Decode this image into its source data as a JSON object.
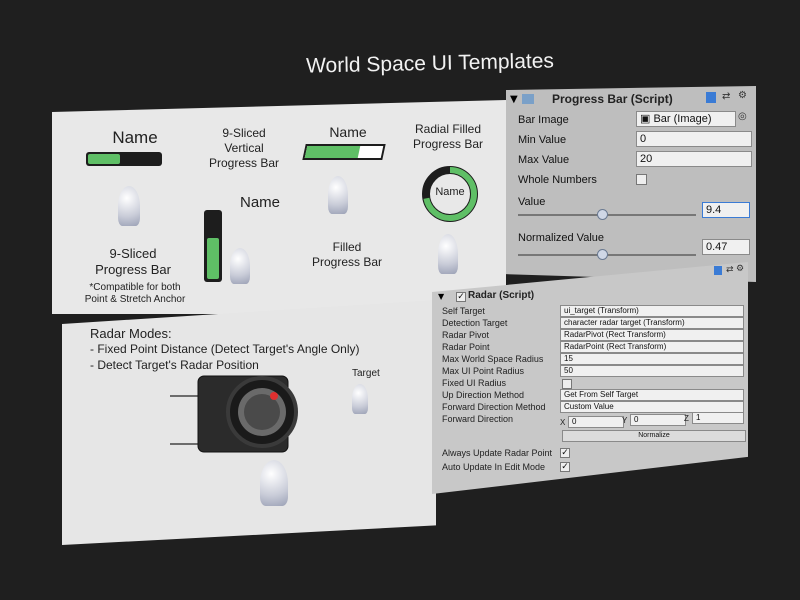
{
  "page_title": "World Space UI Templates",
  "templates": {
    "sliced_bar": {
      "name": "Name",
      "label": "9-Sliced\nProgress Bar",
      "note": "*Compatible for both\nPoint & Stretch Anchor",
      "fill_fraction": 0.45
    },
    "vertical_bar": {
      "label": "9-Sliced\nVertical\nProgress Bar",
      "name": "Name",
      "fill_fraction": 0.62
    },
    "filled_bar": {
      "name": "Name",
      "label": "Filled\nProgress Bar",
      "fill_fraction": 0.7
    },
    "radial_bar": {
      "label": "Radial Filled\nProgress Bar",
      "name": "Name",
      "fill_fraction": 0.72
    }
  },
  "radar_demo": {
    "heading": "Radar Modes:",
    "modes": [
      "- Fixed Point Distance (Detect Target's Angle Only)",
      "- Detect Target's Radar Position"
    ],
    "target_label": "Target"
  },
  "progress_bar_inspector": {
    "component_title": "Progress Bar (Script)",
    "fields": [
      {
        "label": "Bar Image",
        "value": "Bar (Image)"
      },
      {
        "label": "Min Value",
        "value": "0"
      },
      {
        "label": "Max Value",
        "value": "20"
      },
      {
        "label": "Whole Numbers",
        "value": ""
      }
    ],
    "value_label": "Value",
    "value": "9.4",
    "value_fraction": 0.47,
    "normalized_label": "Normalized Value",
    "normalized_value": "0.47",
    "normalized_fraction": 0.47
  },
  "radar_inspector": {
    "component_title": "Radar (Script)",
    "rows": [
      {
        "label": "Self Target",
        "value": "ui_target (Transform)"
      },
      {
        "label": "Detection Target",
        "value": "character radar target (Transform)"
      },
      {
        "label": "Radar Pivot",
        "value": "RadarPivot (Rect Transform)"
      },
      {
        "label": "Radar Point",
        "value": "RadarPoint (Rect Transform)"
      },
      {
        "label": "Max World Space Radius",
        "value": "15"
      },
      {
        "label": "Max UI Point Radius",
        "value": "50"
      },
      {
        "label": "Fixed UI Radius",
        "value": ""
      },
      {
        "label": "Up Direction Method",
        "value": "Get From Self Target"
      },
      {
        "label": "Forward Direction Method",
        "value": "Custom Value"
      },
      {
        "label": "Forward Direction",
        "value": ""
      }
    ],
    "vector": {
      "x_label": "X",
      "x": "0",
      "y_label": "Y",
      "y": "0",
      "z_label": "Z",
      "z": "1"
    },
    "normalize_button": "Normalize",
    "always_update": "Always Update Radar Point",
    "auto_update": "Auto Update In Edit Mode"
  },
  "colors": {
    "fill": "#5fbf66",
    "panel": "#e8e8e8",
    "inspector": "#c0c0c0",
    "field_highlight": "#3a7bd5"
  }
}
